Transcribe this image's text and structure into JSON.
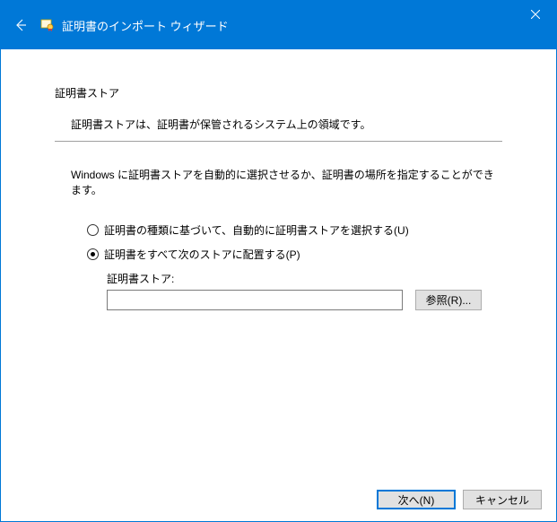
{
  "titlebar": {
    "title": "証明書のインポート ウィザード"
  },
  "content": {
    "section_title": "証明書ストア",
    "section_desc": "証明書ストアは、証明書が保管されるシステム上の領域です。",
    "help_text": "Windows に証明書ストアを自動的に選択させるか、証明書の場所を指定することができます。",
    "radio_auto": "証明書の種類に基づいて、自動的に証明書ストアを選択する(U)",
    "radio_manual": "証明書をすべて次のストアに配置する(P)",
    "store_label": "証明書ストア:",
    "store_value": "",
    "browse_label": "参照(R)..."
  },
  "footer": {
    "next": "次へ(N)",
    "cancel": "キャンセル"
  }
}
